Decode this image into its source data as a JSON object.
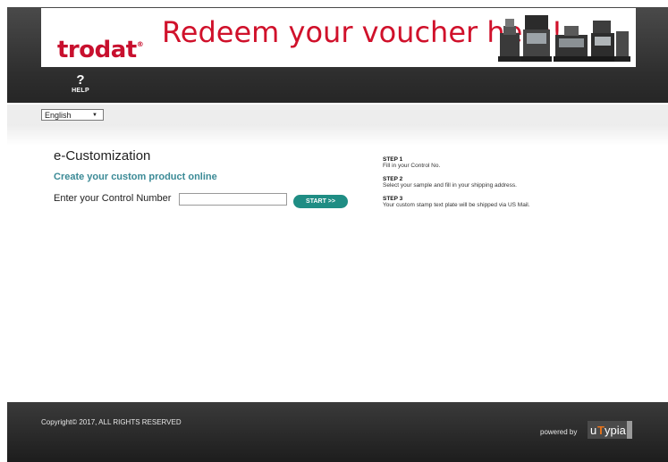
{
  "banner": {
    "logo_text": "trodat",
    "logo_mark": "®",
    "headline": "Redeem your voucher here!"
  },
  "nav": {
    "help_icon": "?",
    "help_label": "HELP"
  },
  "language": {
    "selected": "English",
    "arrow": "▼"
  },
  "main": {
    "title": "e-Customization",
    "subtitle": "Create your custom product online",
    "control_label": "Enter your Control Number",
    "control_value": "",
    "start_button": "START >>"
  },
  "steps": [
    {
      "heading": "STEP 1",
      "text": "Fill in your Control No."
    },
    {
      "heading": "STEP 2",
      "text": "Select your sample and fill in your shipping address."
    },
    {
      "heading": "STEP 3",
      "text": "Your custom stamp text plate will be shipped via US Mail."
    }
  ],
  "footer": {
    "copyright": "Copyright© 2017, ALL RIGHTS RESERVED",
    "powered_by": "powered by",
    "brand_logo": "uTypia"
  },
  "colors": {
    "brand_red": "#d0112b",
    "accent_teal": "#1f8d84",
    "subtitle_teal": "#3b8a96"
  }
}
